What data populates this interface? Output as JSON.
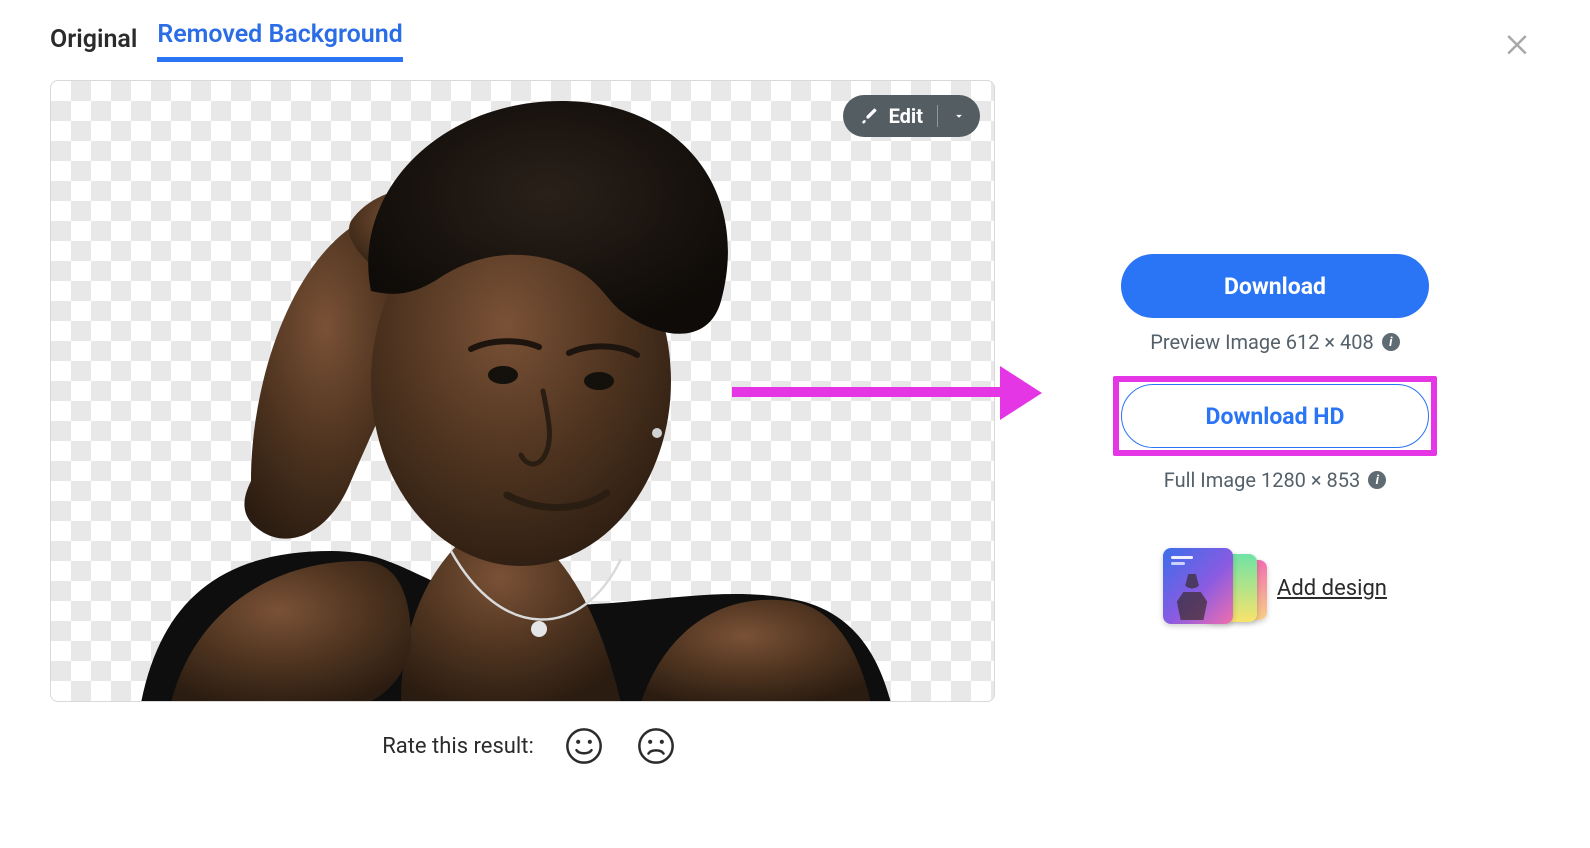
{
  "tabs": {
    "original": "Original",
    "removed_bg": "Removed Background"
  },
  "edit_button": {
    "label": "Edit"
  },
  "rating": {
    "prompt": "Rate this result:"
  },
  "sidebar": {
    "download_label": "Download",
    "preview_text": "Preview Image 612 × 408",
    "download_hd_label": "Download HD",
    "full_text": "Full Image 1280 × 853",
    "add_design_label": "Add design"
  }
}
